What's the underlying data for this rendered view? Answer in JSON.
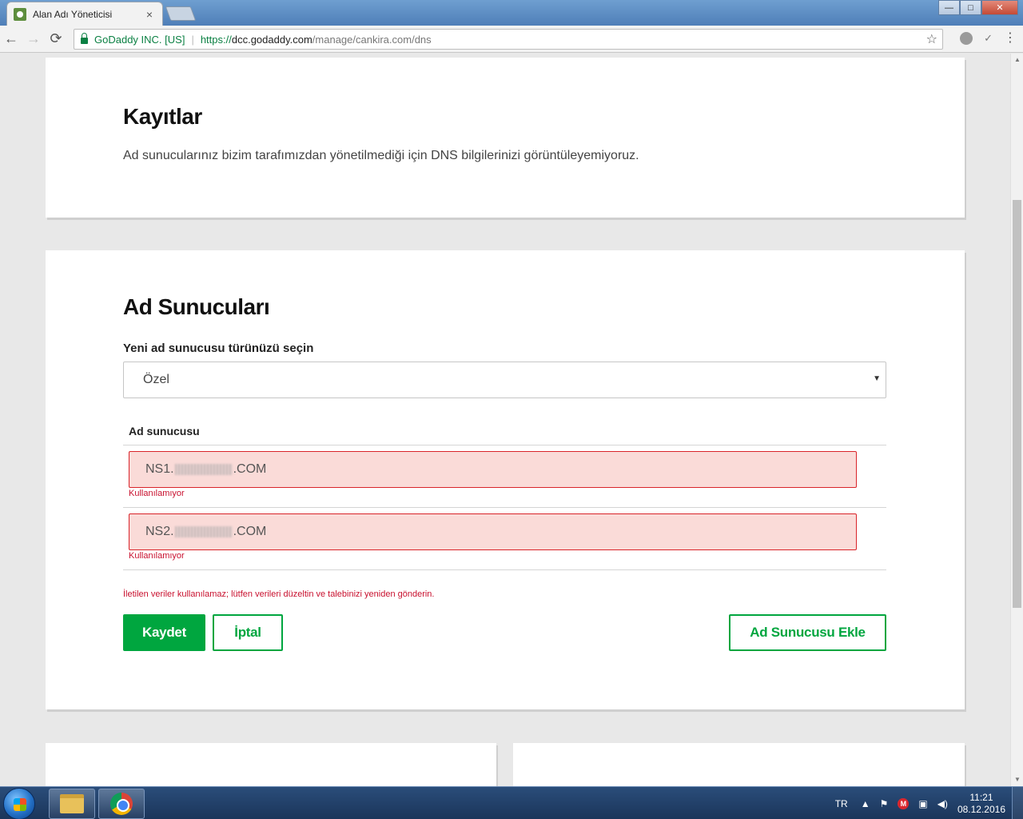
{
  "browser": {
    "tab_title": "Alan Adı Yöneticisi",
    "tab_close": "×",
    "window_controls": {
      "minimize": "—",
      "maximize": "□",
      "close": "✕"
    },
    "secure_org": "GoDaddy INC. [US]",
    "url_scheme": "https://",
    "url_host": "dcc.godaddy.com",
    "url_path": "/manage/cankira.com/dns",
    "nav": {
      "back": "←",
      "forward": "→",
      "reload": "⟳"
    },
    "star": "☆",
    "check": "✓",
    "menu": "⋮"
  },
  "records_card": {
    "title": "Kayıtlar",
    "description": "Ad sunucularınız bizim tarafımızdan yönetilmediği için DNS bilgilerinizi görüntüleyemiyoruz."
  },
  "nameservers_card": {
    "title": "Ad Sunucuları",
    "select_label": "Yeni ad sunucusu türünüzü seçin",
    "select_value": "Özel",
    "select_caret": "▼",
    "column_header": "Ad sunucusu",
    "nameservers": [
      {
        "prefix": "NS1.",
        "suffix": ".COM",
        "error": "Kullanılamıyor"
      },
      {
        "prefix": "NS2.",
        "suffix": ".COM",
        "error": "Kullanılamıyor"
      }
    ],
    "form_error": "İletilen veriler kullanılamaz; lütfen verileri düzeltin ve talebinizi yeniden gönderin.",
    "save_label": "Kaydet",
    "cancel_label": "İptal",
    "add_label": "Ad Sunucusu Ekle"
  },
  "taskbar": {
    "language": "TR",
    "tray_arrow": "▲",
    "tray_flag": "⚑",
    "tray_mega": "M",
    "tray_network": "▣",
    "tray_volume": "◀)",
    "time": "11:21",
    "date": "08.12.2016"
  },
  "colors": {
    "accent_green": "#00a63f",
    "error_red": "#c8102e",
    "error_bg": "#fadbd8"
  }
}
